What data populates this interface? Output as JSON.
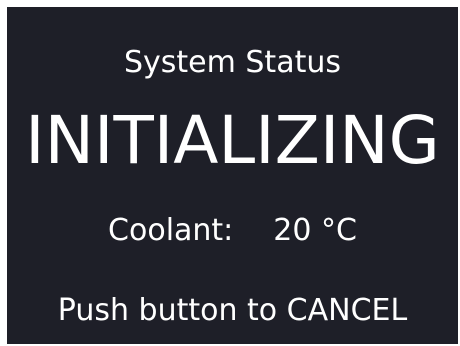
{
  "screen": {
    "title": "System Status",
    "status": "INITIALIZING",
    "coolant": {
      "label": "Coolant:",
      "value": "20 °C"
    },
    "prompt": "Push button to CANCEL",
    "colors": {
      "background": "#1e1f28",
      "text": "#ffffff"
    }
  }
}
